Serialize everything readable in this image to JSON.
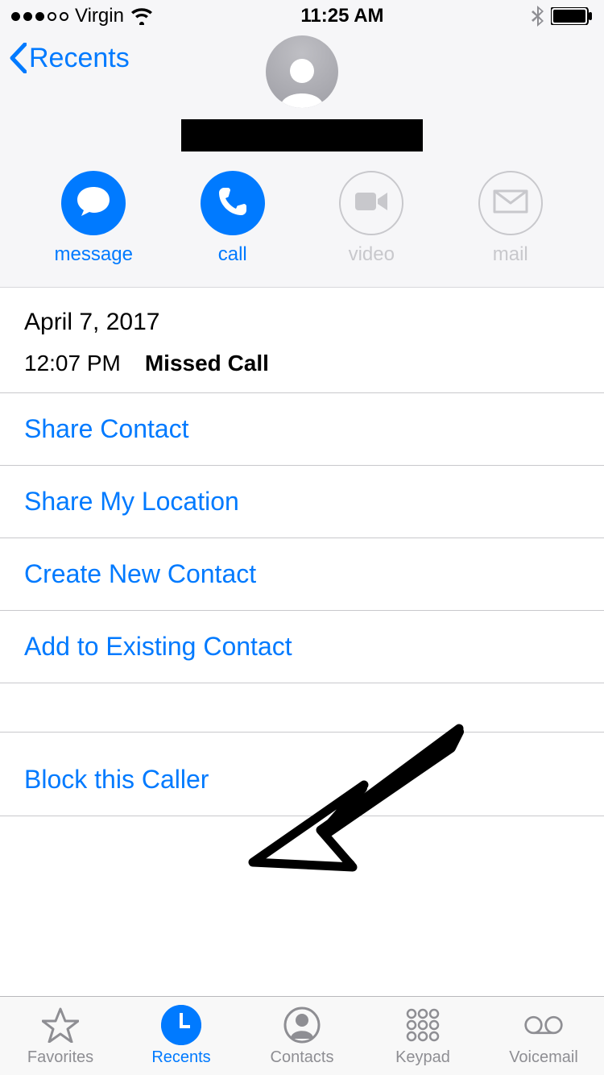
{
  "statusBar": {
    "carrier": "Virgin",
    "time": "11:25 AM"
  },
  "header": {
    "back_label": "Recents"
  },
  "actions": {
    "message": "message",
    "call": "call",
    "video": "video",
    "mail": "mail"
  },
  "callLog": {
    "date": "April 7, 2017",
    "time": "12:07 PM",
    "type": "Missed Call"
  },
  "options": {
    "share_contact": "Share Contact",
    "share_location": "Share My Location",
    "create_contact": "Create New Contact",
    "add_existing": "Add to Existing Contact",
    "block": "Block this Caller"
  },
  "tabs": {
    "favorites": "Favorites",
    "recents": "Recents",
    "contacts": "Contacts",
    "keypad": "Keypad",
    "voicemail": "Voicemail"
  }
}
